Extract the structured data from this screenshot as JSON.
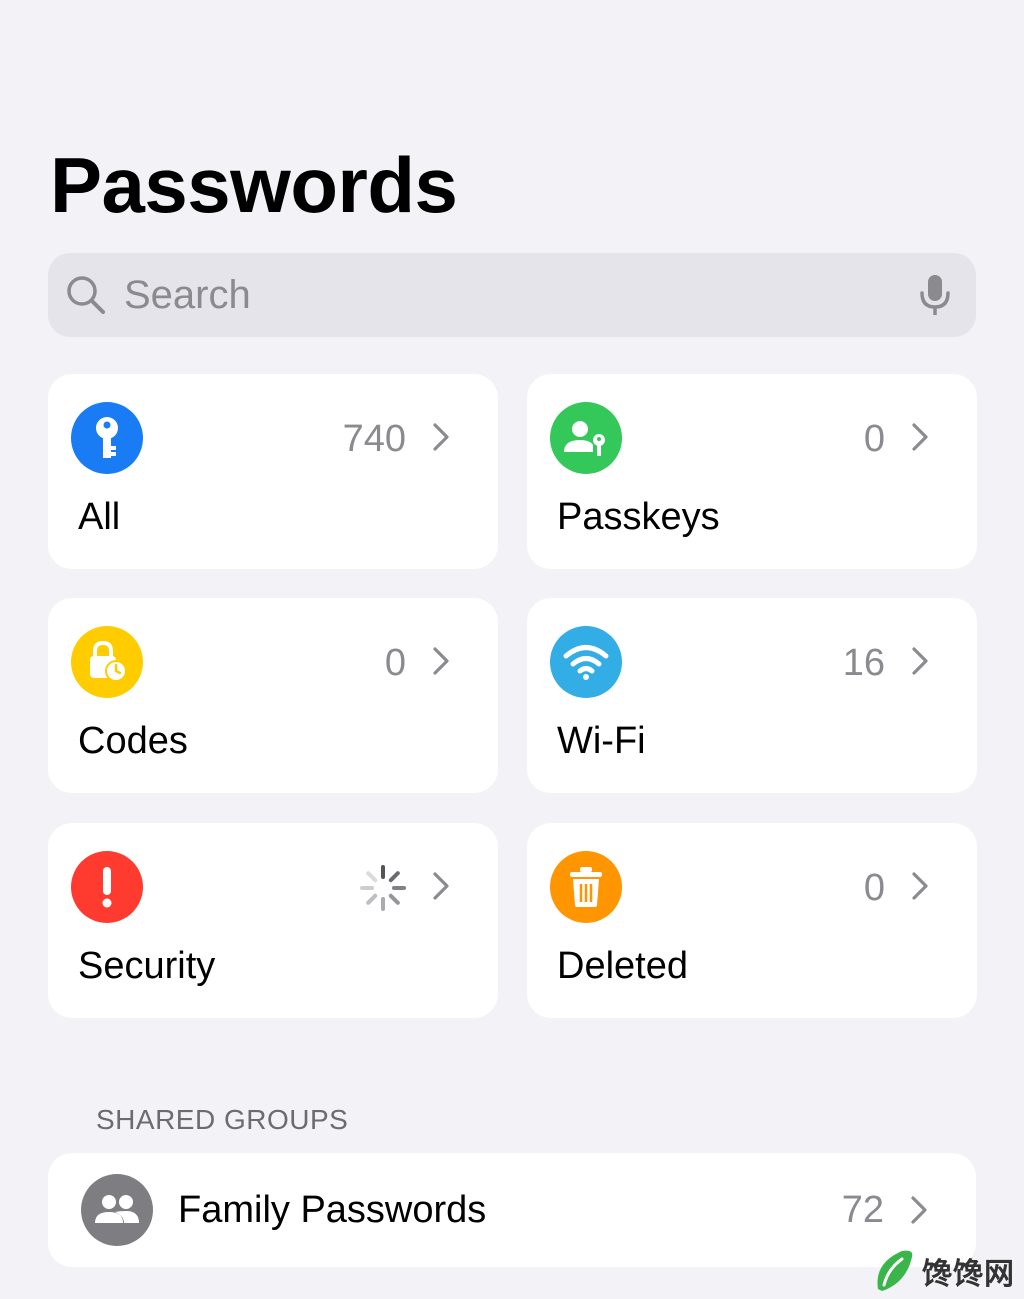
{
  "page": {
    "title": "Passwords"
  },
  "search": {
    "placeholder": "Search",
    "icon": "search-icon",
    "mic_icon": "microphone-icon"
  },
  "categories": [
    {
      "label": "All",
      "count": "740",
      "icon": "key-icon",
      "color": "#1a7cf5"
    },
    {
      "label": "Passkeys",
      "count": "0",
      "icon": "person-key-icon",
      "color": "#34c759"
    },
    {
      "label": "Codes",
      "count": "0",
      "icon": "lock-clock-icon",
      "color": "#ffcc00"
    },
    {
      "label": "Wi-Fi",
      "count": "16",
      "icon": "wifi-icon",
      "color": "#32ade6"
    },
    {
      "label": "Security",
      "count": "",
      "icon": "exclamation-icon",
      "color": "#ff3b30",
      "loading": true
    },
    {
      "label": "Deleted",
      "count": "0",
      "icon": "trash-icon",
      "color": "#ff9500"
    }
  ],
  "shared_groups": {
    "header": "SHARED GROUPS",
    "items": [
      {
        "name": "Family Passwords",
        "count": "72",
        "icon": "people-icon"
      }
    ]
  },
  "watermark": {
    "text": "馋馋网"
  }
}
